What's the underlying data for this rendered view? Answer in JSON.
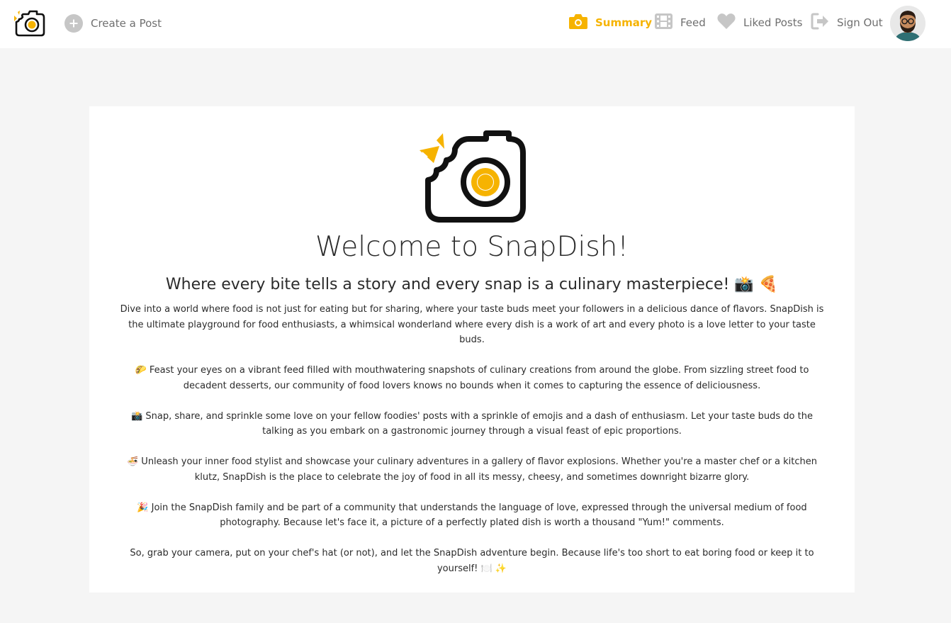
{
  "header": {
    "create_post_label": "Create a Post",
    "nav": {
      "summary": "Summary",
      "feed": "Feed",
      "liked": "Liked Posts",
      "signout": "Sign Out"
    }
  },
  "colors": {
    "accent": "#f6b300",
    "nav_text": "#6f6f6f",
    "icon_gray": "#c6c6c6",
    "background": "#f5f5f5"
  },
  "main": {
    "title": "Welcome to SnapDish!",
    "subtitle": "Where every bite tells a story and every snap is a culinary masterpiece! 📸 🍕",
    "paragraphs": [
      "Dive into a world where food is not just for eating but for sharing, where your taste buds meet your followers in a delicious dance of flavors. SnapDish is the ultimate playground for food enthusiasts, a whimsical wonderland where every dish is a work of art and every photo is a love letter to your taste buds.",
      "🌮 Feast your eyes on a vibrant feed filled with mouthwatering snapshots of culinary creations from around the globe. From sizzling street food to decadent desserts, our community of food lovers knows no bounds when it comes to capturing the essence of deliciousness.",
      "📸 Snap, share, and sprinkle some love on your fellow foodies' posts with a sprinkle of emojis and a dash of enthusiasm. Let your taste buds do the talking as you embark on a gastronomic journey through a visual feast of epic proportions.",
      "🍜 Unleash your inner food stylist and showcase your culinary adventures in a gallery of flavor explosions. Whether you're a master chef or a kitchen klutz, SnapDish is the place to celebrate the joy of food in all its messy, cheesy, and sometimes downright bizarre glory.",
      "🎉 Join the SnapDish family and be part of a community that understands the language of love, expressed through the universal medium of food photography. Because let's face it, a picture of a perfectly plated dish is worth a thousand \"Yum!\" comments.",
      "So, grab your camera, put on your chef's hat (or not), and let the SnapDish adventure begin. Because life's too short to eat boring food or keep it to yourself! 🍽️ ✨"
    ]
  },
  "icons": {
    "logo": "camera-bite-icon",
    "create": "plus-circle-icon",
    "summary": "camera-icon",
    "feed": "film-icon",
    "liked": "heart-icon",
    "signout": "sign-out-icon",
    "avatar": "user-avatar"
  }
}
